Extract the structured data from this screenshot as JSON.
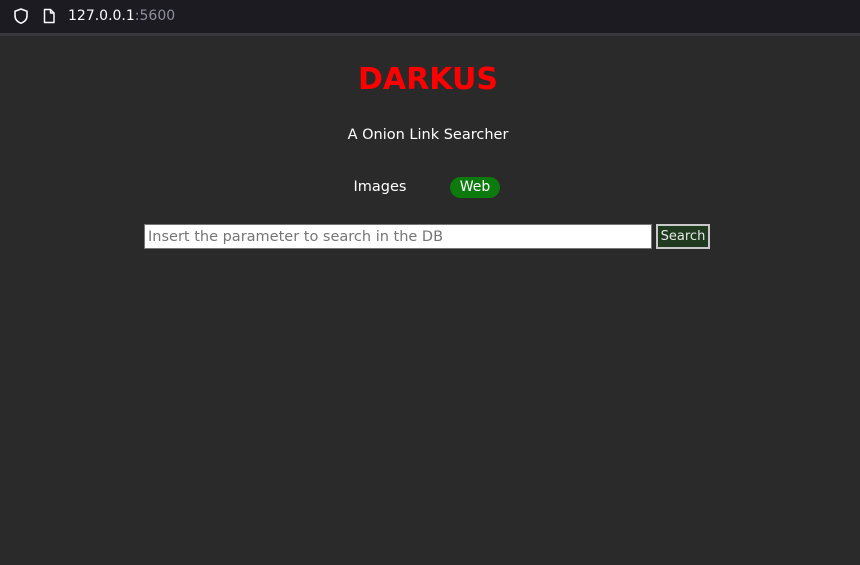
{
  "browser": {
    "url_host": "127.0.0.1",
    "url_port": ":5600",
    "icons": [
      "shield-icon",
      "page-icon"
    ]
  },
  "page": {
    "title": "DARKUS",
    "subtitle": "A Onion Link Searcher",
    "nav": {
      "images_label": "Images",
      "web_label": "Web"
    },
    "search": {
      "placeholder": "Insert the parameter to search in the DB",
      "value": "",
      "button_label": "Search"
    }
  },
  "colors": {
    "title": "#ff0000",
    "background": "#2a2a2a",
    "active_nav": "#0c7a0c",
    "search_button": "#1f3a1f"
  }
}
